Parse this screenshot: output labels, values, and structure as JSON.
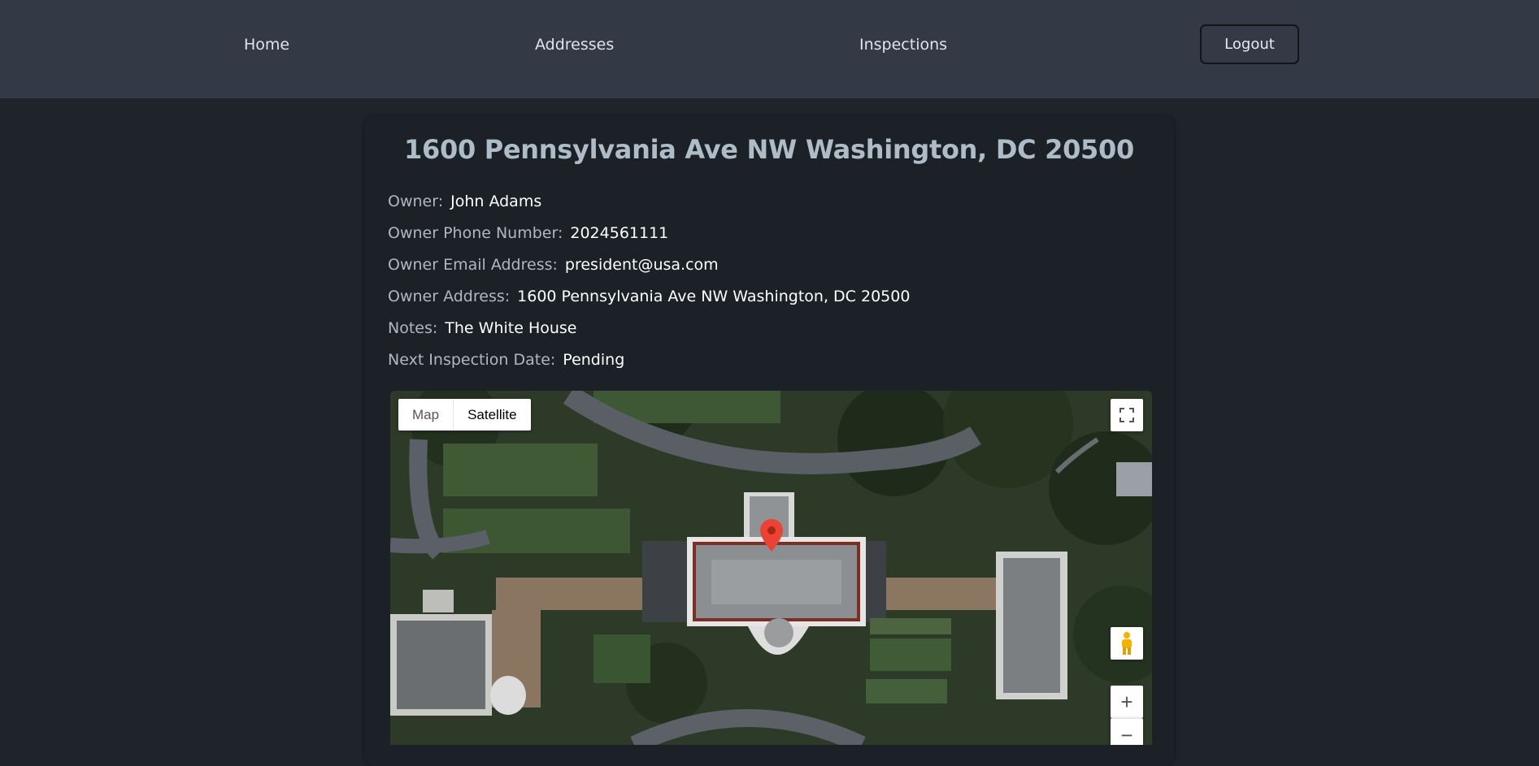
{
  "nav": {
    "home": "Home",
    "addresses": "Addresses",
    "inspections": "Inspections",
    "logout": "Logout"
  },
  "property": {
    "title": "1600 Pennsylvania Ave NW Washington, DC 20500",
    "fields": [
      {
        "label": "Owner:",
        "value": "John Adams"
      },
      {
        "label": "Owner Phone Number:",
        "value": "2024561111"
      },
      {
        "label": "Owner Email Address:",
        "value": "president@usa.com"
      },
      {
        "label": "Owner Address:",
        "value": "1600 Pennsylvania Ave NW Washington, DC 20500"
      },
      {
        "label": "Notes:",
        "value": "The White House"
      },
      {
        "label": "Next Inspection Date:",
        "value": "Pending"
      }
    ]
  },
  "map": {
    "type_map_label": "Map",
    "type_satellite_label": "Satellite",
    "selected_type": "Satellite",
    "zoom_in_label": "+",
    "zoom_out_label": "−",
    "icons": [
      "fullscreen-icon",
      "pegman-icon",
      "map-marker-icon",
      "street-view-thumbnail"
    ],
    "marker_color": "#ea4335"
  },
  "colors": {
    "navbar": "#333a46",
    "page_bg": "#1f242b",
    "card_bg": "#1c2127",
    "title": "#aebcc7"
  }
}
